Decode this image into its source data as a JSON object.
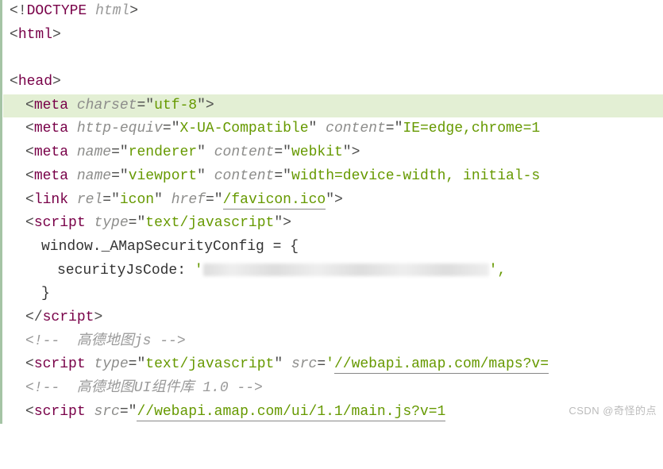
{
  "lines": {
    "l1": {
      "tag": "!DOCTYPE",
      "doctype_val": "html"
    },
    "l2": {
      "tag": "html"
    },
    "l4": {
      "tag": "head"
    },
    "l5": {
      "tag": "meta",
      "attrs": [
        {
          "name": "charset",
          "val": "utf-8"
        }
      ]
    },
    "l6": {
      "tag": "meta",
      "attrs": [
        {
          "name": "http-equiv",
          "val": "X-UA-Compatible"
        },
        {
          "name": "content",
          "val": "IE=edge,chrome=1"
        }
      ]
    },
    "l7": {
      "tag": "meta",
      "attrs": [
        {
          "name": "name",
          "val": "renderer"
        },
        {
          "name": "content",
          "val": "webkit"
        }
      ]
    },
    "l8": {
      "tag": "meta",
      "attrs": [
        {
          "name": "name",
          "val": "viewport"
        },
        {
          "name": "content",
          "val": "width=device-width, initial-s"
        }
      ]
    },
    "l9": {
      "tag": "link",
      "attrs": [
        {
          "name": "rel",
          "val": "icon"
        },
        {
          "name": "href",
          "val": "/favicon.ico",
          "ul": true
        }
      ]
    },
    "l10": {
      "tag": "script",
      "attrs": [
        {
          "name": "type",
          "val": "text/javascript"
        }
      ]
    },
    "l11": {
      "text": "window._AMapSecurityConfig = {"
    },
    "l12": {
      "key": "securityJsCode",
      "sep": ": ",
      "q": "'",
      "trail": "',"
    },
    "l13": {
      "text": "}"
    },
    "l14": {
      "close": "script"
    },
    "l15": {
      "comment": "<!--  高德地图js -->"
    },
    "l16": {
      "tag": "script",
      "attrs": [
        {
          "name": "type",
          "val": "text/javascript"
        },
        {
          "name": "src",
          "val": "//webapi.amap.com/maps?v=",
          "ul": true
        }
      ]
    },
    "l17": {
      "comment": "<!--  高德地图UI组件库 1.0 -->"
    },
    "l18": {
      "tag": "script",
      "attrs": [
        {
          "name": "src",
          "val": "//webapi.amap.com/ui/1.1/main.js?v=1",
          "ul": true
        }
      ]
    }
  },
  "glyphs": {
    "lt": "<",
    "gt": ">",
    "eq": "=",
    "dq": "\"",
    "slash": "/"
  },
  "watermark": "CSDN @奇怪的点"
}
